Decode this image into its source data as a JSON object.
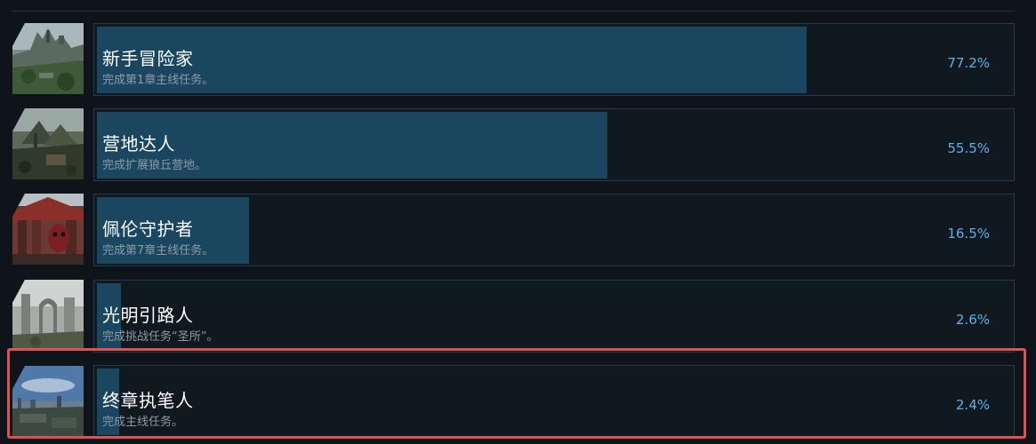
{
  "achievements": [
    {
      "title": "新手冒险家",
      "desc": "完成第1章主线任务。",
      "percent_label": "77.2%",
      "percent": 77.2,
      "thumb_icon": "castle-landscape-icon"
    },
    {
      "title": "营地达人",
      "desc": "完成扩展狼丘营地。",
      "percent_label": "55.5%",
      "percent": 55.5,
      "thumb_icon": "camp-landscape-icon"
    },
    {
      "title": "佩伦守护者",
      "desc": "完成第7章主线任务。",
      "percent_label": "16.5%",
      "percent": 16.5,
      "thumb_icon": "temple-mask-icon"
    },
    {
      "title": "光明引路人",
      "desc": "完成挑战任务“圣所”。",
      "percent_label": "2.6%",
      "percent": 2.6,
      "thumb_icon": "ruins-landscape-icon"
    },
    {
      "title": "终章执笔人",
      "desc": "完成主线任务。",
      "percent_label": "2.4%",
      "percent": 2.4,
      "thumb_icon": "city-skyline-icon"
    }
  ],
  "highlighted_index": 4,
  "colors": {
    "background": "#0f141a",
    "bar_fill": "#1a475f",
    "percent_text": "#5fb0e6",
    "highlight": "#e05152"
  }
}
